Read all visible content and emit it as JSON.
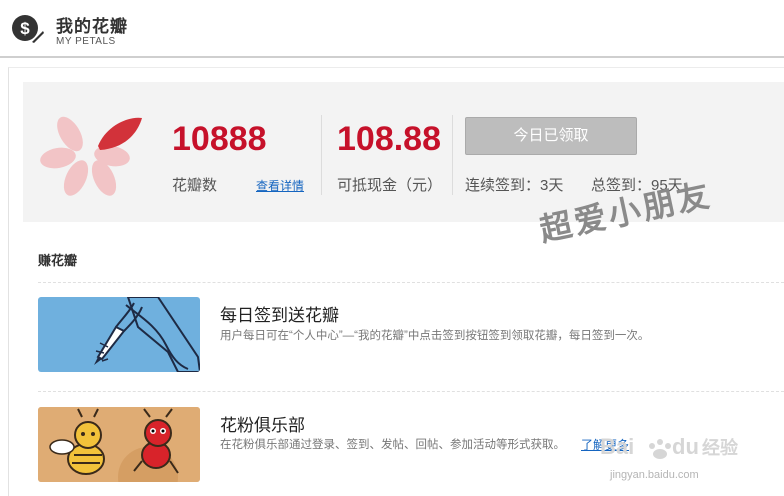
{
  "header": {
    "title": "我的花瓣",
    "subtitle": "MY PETALS",
    "logo_letter": "$"
  },
  "summary": {
    "petals_value": "10888",
    "petals_label": "花瓣数",
    "details_link": "查看详情",
    "cash_value": "108.88",
    "cash_label": "可抵现金（元）",
    "claimed_button": "今日已领取",
    "consecutive_label": "连续签到：3天",
    "total_label": "总签到：95天"
  },
  "earn": {
    "section_title": "赚花瓣",
    "items": [
      {
        "title": "每日签到送花瓣",
        "description": "用户每日可在“个人中心”—“我的花瓣”中点击签到按钮签到领取花瓣，每日签到一次。"
      },
      {
        "title": "花粉俱乐部",
        "description": "在花粉俱乐部通过登录、签到、发帖、回帖、参加活动等形式获取。",
        "link": "了解更多"
      }
    ]
  },
  "watermarks": {
    "handwritten": "超爱小朋友",
    "baidu_logo": "Bai du 经验",
    "baidu_url": "jingyan.baidu.com"
  },
  "colors": {
    "accent_red": "#c6112a",
    "link_blue": "#1565c0",
    "petal_pink": "#f2c4c6",
    "petal_red": "#d2323a",
    "disabled_button": "#bdbdbd",
    "signin_banner": "#6fb0de"
  }
}
